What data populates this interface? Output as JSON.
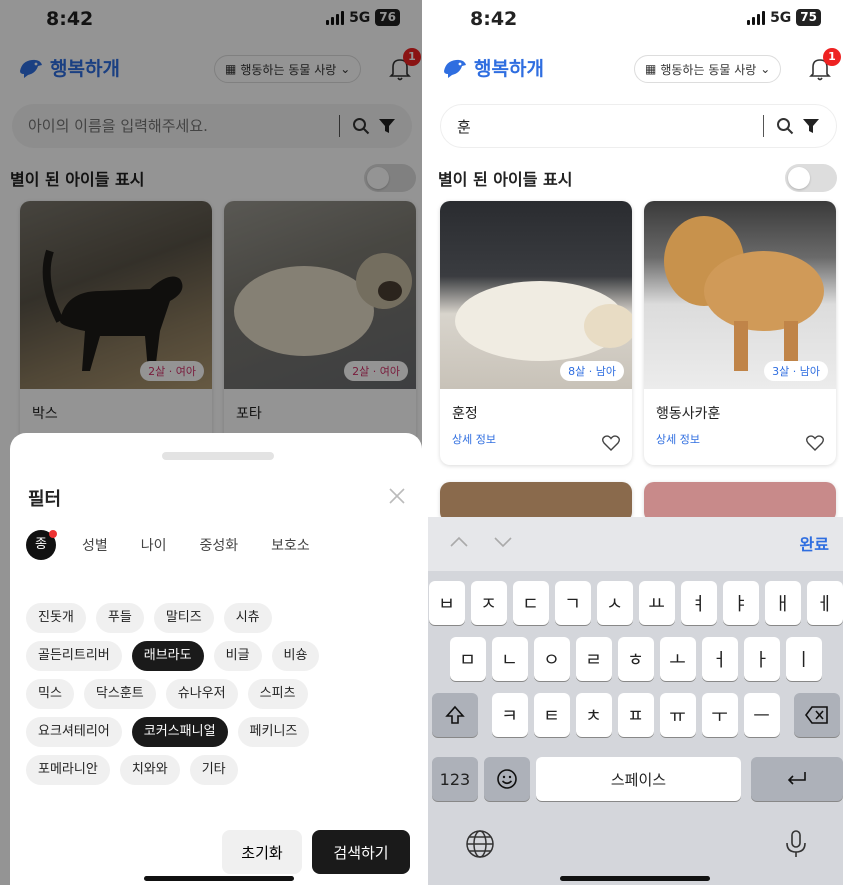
{
  "status": {
    "time": "8:42",
    "network": "5G",
    "battery_left": "76",
    "battery_right": "75"
  },
  "app": {
    "logo": "행복하개",
    "shelter_select": "행동하는 동물 사랑",
    "notification_count": "1"
  },
  "search": {
    "placeholder": "아이의 이름을 입력해주세요.",
    "value": "훈"
  },
  "toggle_label": "별이 된 아이들 표시",
  "left_cards": [
    {
      "name": "박스",
      "age_sex": "2살 · 여아"
    },
    {
      "name": "포타",
      "age_sex": "2살 · 여아"
    }
  ],
  "right_cards": [
    {
      "name": "훈정",
      "age_sex": "8살 · 남아",
      "detail": "상세 정보"
    },
    {
      "name": "행동사카훈",
      "age_sex": "3살 · 남아",
      "detail": "상세 정보"
    }
  ],
  "filter": {
    "title": "필터",
    "active_tab": "종",
    "tabs": [
      "성별",
      "나이",
      "중성화",
      "보호소"
    ],
    "chips": [
      {
        "label": "진돗개",
        "selected": false
      },
      {
        "label": "푸들",
        "selected": false
      },
      {
        "label": "말티즈",
        "selected": false
      },
      {
        "label": "시츄",
        "selected": false
      },
      {
        "label": "골든리트리버",
        "selected": false
      },
      {
        "label": "래브라도",
        "selected": true
      },
      {
        "label": "비글",
        "selected": false
      },
      {
        "label": "비숑",
        "selected": false
      },
      {
        "label": "믹스",
        "selected": false
      },
      {
        "label": "닥스훈트",
        "selected": false
      },
      {
        "label": "슈나우저",
        "selected": false
      },
      {
        "label": "스피츠",
        "selected": false
      },
      {
        "label": "요크셔테리어",
        "selected": false
      },
      {
        "label": "코커스패니얼",
        "selected": true
      },
      {
        "label": "페키니즈",
        "selected": false
      },
      {
        "label": "포메라니안",
        "selected": false
      },
      {
        "label": "치와와",
        "selected": false
      },
      {
        "label": "기타",
        "selected": false
      }
    ],
    "reset": "초기화",
    "submit": "검색하기"
  },
  "keyboard": {
    "done": "완료",
    "row1": [
      "ㅂ",
      "ㅈ",
      "ㄷ",
      "ㄱ",
      "ㅅ",
      "ㅛ",
      "ㅕ",
      "ㅑ",
      "ㅐ",
      "ㅔ"
    ],
    "row2": [
      "ㅁ",
      "ㄴ",
      "ㅇ",
      "ㄹ",
      "ㅎ",
      "ㅗ",
      "ㅓ",
      "ㅏ",
      "ㅣ"
    ],
    "row3": [
      "ㅋ",
      "ㅌ",
      "ㅊ",
      "ㅍ",
      "ㅠ",
      "ㅜ",
      "ㅡ"
    ],
    "numbers": "123",
    "space": "스페이스"
  }
}
